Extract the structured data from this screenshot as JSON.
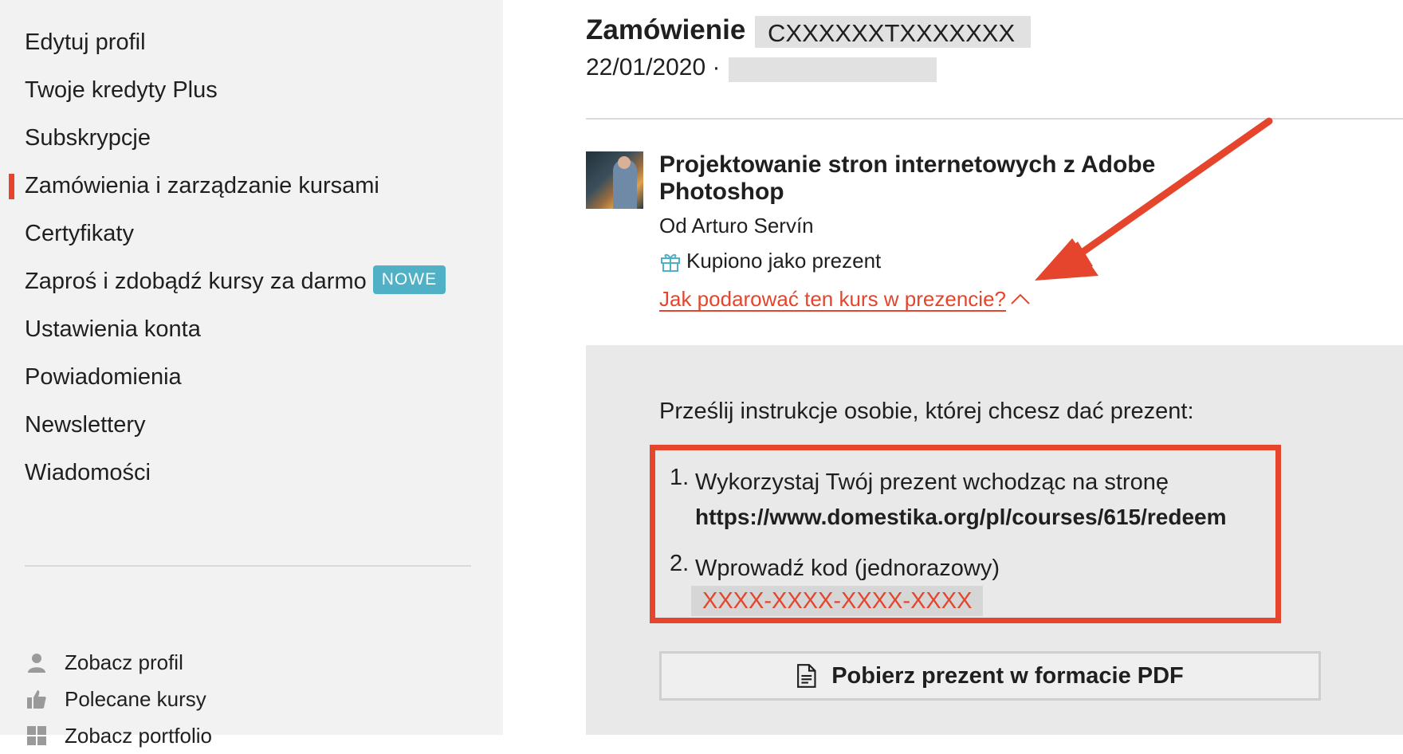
{
  "sidebar": {
    "items": [
      {
        "label": "Edytuj profil"
      },
      {
        "label": "Twoje kredyty Plus"
      },
      {
        "label": "Subskrypcje"
      },
      {
        "label": "Zamówienia i zarządzanie kursami",
        "active": true
      },
      {
        "label": "Certyfikaty"
      },
      {
        "label": "Zaproś i zdobądź kursy za darmo",
        "badge": "NOWE"
      },
      {
        "label": "Ustawienia konta"
      },
      {
        "label": "Powiadomienia"
      },
      {
        "label": "Newslettery"
      },
      {
        "label": "Wiadomości"
      }
    ],
    "links": [
      {
        "label": "Zobacz profil",
        "icon": "user-icon"
      },
      {
        "label": "Polecane kursy",
        "icon": "thumbs-up-icon"
      },
      {
        "label": "Zobacz portfolio",
        "icon": "grid-icon"
      }
    ]
  },
  "order": {
    "title_prefix": "Zamówienie",
    "order_number_redacted": "CXXXXXXTXXXXXXX",
    "date": "22/01/2020 ·"
  },
  "course": {
    "title": "Projektowanie stron internetowych z Adobe Photoshop",
    "author": "Od Arturo Servín",
    "purchase_type": "Kupiono jako prezent",
    "gift_help_link": "Jak podarować ten kurs w prezencie?"
  },
  "gift_panel": {
    "intro": "Prześlij instrukcje osobie, której chcesz dać prezent:",
    "step1_num": "1.",
    "step1_text": "Wykorzystaj Twój prezent wchodząc na stronę",
    "step1_url": "https://www.domestika.org/pl/courses/615/redeem",
    "step2_num": "2.",
    "step2_text": "Wprowadź kod (jednorazowy)",
    "code": "XXXX-XXXX-XXXX-XXXX",
    "pdf_button": "Pobierz prezent w formacie PDF"
  },
  "colors": {
    "accent": "#e5452c",
    "badge": "#4fb0c6",
    "sidebar_bg": "#f2f2f2",
    "panel_bg": "#e9e9e9"
  }
}
